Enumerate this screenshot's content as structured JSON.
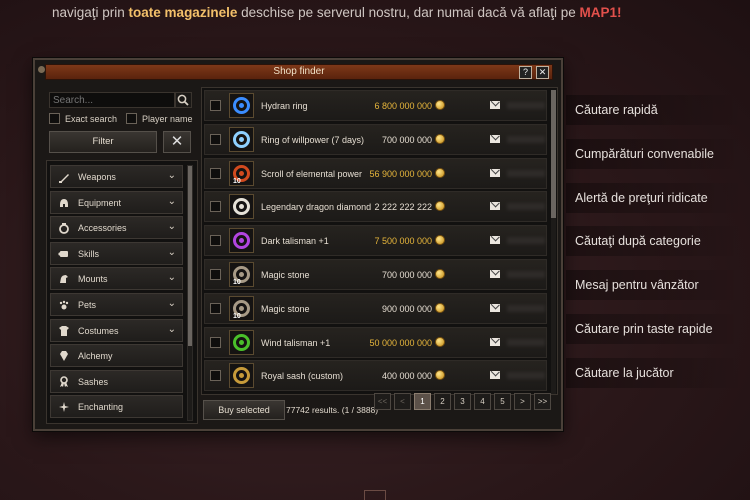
{
  "intro": {
    "part1": "navigaţi prin ",
    "highlight1": "toate magazinele",
    "part2": " deschise pe serverul nostru, dar numai dacă vă aflaţi pe ",
    "highlight2": "MAP1",
    "part3": "!"
  },
  "window": {
    "title": "Shop finder",
    "help_label": "?",
    "close_label": "✕"
  },
  "left": {
    "search_placeholder": "Search...",
    "exact_search_label": "Exact search",
    "player_name_label": "Player name",
    "filter_label": "Filter",
    "clear_label": "✕",
    "categories": [
      {
        "label": "Weapons",
        "icon": "sword-icon",
        "expandable": true
      },
      {
        "label": "Equipment",
        "icon": "helmet-icon",
        "expandable": true
      },
      {
        "label": "Accessories",
        "icon": "ring-icon",
        "expandable": true
      },
      {
        "label": "Skills",
        "icon": "scroll-icon",
        "expandable": true
      },
      {
        "label": "Mounts",
        "icon": "horse-icon",
        "expandable": true
      },
      {
        "label": "Pets",
        "icon": "paw-icon",
        "expandable": true
      },
      {
        "label": "Costumes",
        "icon": "shirt-icon",
        "expandable": true
      },
      {
        "label": "Alchemy",
        "icon": "gem-icon",
        "expandable": false
      },
      {
        "label": "Sashes",
        "icon": "ribbon-icon",
        "expandable": false
      },
      {
        "label": "Enchanting",
        "icon": "sparkle-icon",
        "expandable": false
      }
    ]
  },
  "items": [
    {
      "name": "Hydran ring",
      "price": "6 800 000 000",
      "price_color": "#e7b63b",
      "icon": "hydran-ring-icon",
      "icon_color": "#3b8dff",
      "qty": ""
    },
    {
      "name": "Ring of willpower (7 days)",
      "price": "700 000 000",
      "price_color": "#e6ded2",
      "icon": "willpower-ring-icon",
      "icon_color": "#8ed0ff",
      "qty": ""
    },
    {
      "name": "Scroll of elemental power",
      "price": "56 900 000 000",
      "price_color": "#e7b63b",
      "icon": "elemental-scroll-icon",
      "icon_color": "#d24a1e",
      "qty": "10"
    },
    {
      "name": "Legendary dragon diamond",
      "price": "2 222 222 222",
      "price_color": "#e6ded2",
      "icon": "dragon-diamond-icon",
      "icon_color": "#e6e2d8",
      "qty": ""
    },
    {
      "name": "Dark talisman +1",
      "price": "7 500 000 000",
      "price_color": "#e7b63b",
      "icon": "dark-talisman-icon",
      "icon_color": "#b245e0",
      "qty": ""
    },
    {
      "name": "Magic stone",
      "price": "700 000 000",
      "price_color": "#e6ded2",
      "icon": "magic-stone-icon",
      "icon_color": "#a79a86",
      "qty": "10"
    },
    {
      "name": "Magic stone",
      "price": "900 000 000",
      "price_color": "#e6ded2",
      "icon": "magic-stone-icon",
      "icon_color": "#a79a86",
      "qty": "10"
    },
    {
      "name": "Wind talisman +1",
      "price": "50 000 000 000",
      "price_color": "#e7b63b",
      "icon": "wind-talisman-icon",
      "icon_color": "#4ac02a",
      "qty": ""
    },
    {
      "name": "Royal sash (custom)",
      "price": "400 000 000",
      "price_color": "#e6ded2",
      "icon": "royal-sash-icon",
      "icon_color": "#c79b3a",
      "qty": ""
    }
  ],
  "bottom": {
    "buy_label": "Buy selected",
    "results_text": "77742 results. (1 / 3888)",
    "pages": [
      "<<",
      "<",
      "1",
      "2",
      "3",
      "4",
      "5",
      ">",
      ">>"
    ],
    "active_page": "1"
  },
  "features": [
    "Căutare rapidă",
    "Cumpărături convenabile",
    "Alertă de preţuri ridicate",
    "Căutaţi după categorie",
    "Mesaj pentru vânzător",
    "Căutare prin taste rapide",
    "Căutare la jucător"
  ]
}
